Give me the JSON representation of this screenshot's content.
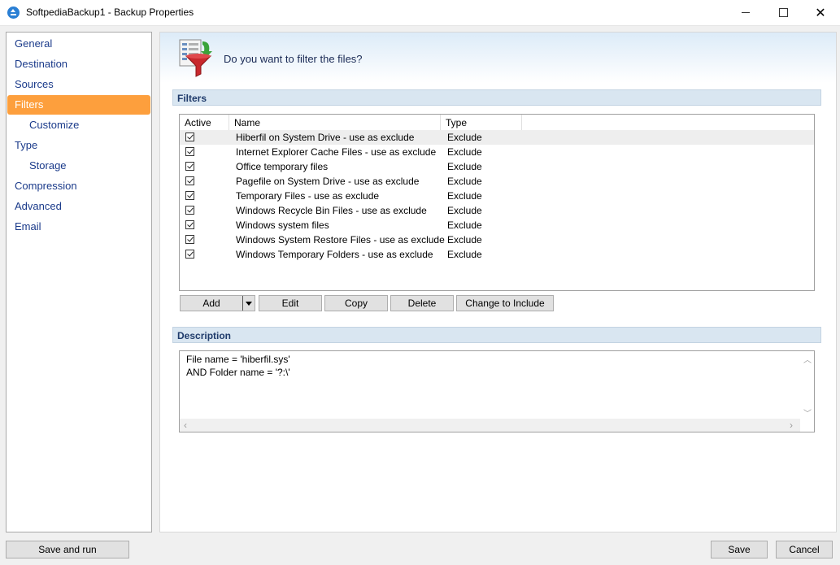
{
  "window": {
    "title": "SoftpediaBackup1 - Backup Properties"
  },
  "sidebar": {
    "items": [
      {
        "label": "General",
        "sub": false,
        "active": false
      },
      {
        "label": "Destination",
        "sub": false,
        "active": false
      },
      {
        "label": "Sources",
        "sub": false,
        "active": false
      },
      {
        "label": "Filters",
        "sub": false,
        "active": true
      },
      {
        "label": "Customize",
        "sub": true,
        "active": false
      },
      {
        "label": "Type",
        "sub": false,
        "active": false
      },
      {
        "label": "Storage",
        "sub": true,
        "active": false
      },
      {
        "label": "Compression",
        "sub": false,
        "active": false
      },
      {
        "label": "Advanced",
        "sub": false,
        "active": false
      },
      {
        "label": "Email",
        "sub": false,
        "active": false
      }
    ]
  },
  "header": {
    "question": "Do you want to filter the files?"
  },
  "filters": {
    "section_title": "Filters",
    "columns": {
      "active": "Active",
      "name": "Name",
      "type": "Type"
    },
    "rows": [
      {
        "name": "Hiberfil on System Drive - use as exclude",
        "type": "Exclude",
        "checked": true
      },
      {
        "name": "Internet Explorer Cache Files - use as exclude",
        "type": "Exclude",
        "checked": true
      },
      {
        "name": "Office temporary files",
        "type": "Exclude",
        "checked": true
      },
      {
        "name": "Pagefile on System Drive - use as exclude",
        "type": "Exclude",
        "checked": true
      },
      {
        "name": "Temporary Files - use as exclude",
        "type": "Exclude",
        "checked": true
      },
      {
        "name": "Windows Recycle Bin Files - use as exclude",
        "type": "Exclude",
        "checked": true
      },
      {
        "name": "Windows system files",
        "type": "Exclude",
        "checked": true
      },
      {
        "name": "Windows System Restore Files - use as exclude",
        "type": "Exclude",
        "checked": true
      },
      {
        "name": "Windows Temporary Folders - use as exclude",
        "type": "Exclude",
        "checked": true
      }
    ],
    "buttons": {
      "add": "Add",
      "edit": "Edit",
      "copy": "Copy",
      "delete": "Delete",
      "change": "Change to Include"
    }
  },
  "description": {
    "section_title": "Description",
    "lines": [
      "File name = 'hiberfil.sys'",
      "AND Folder name = '?:\\'"
    ]
  },
  "footer": {
    "save_and_run": "Save and run",
    "save": "Save",
    "cancel": "Cancel"
  }
}
